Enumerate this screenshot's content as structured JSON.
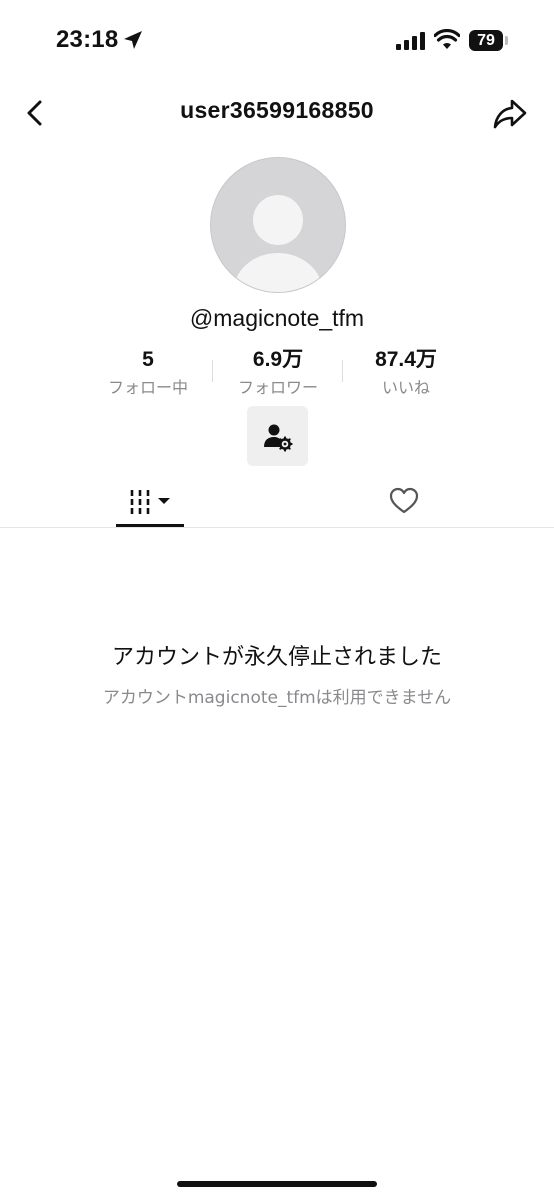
{
  "status_bar": {
    "time": "23:18",
    "battery": "79",
    "icons": [
      "location-arrow-icon",
      "signal-icon",
      "wifi-icon",
      "battery-icon"
    ]
  },
  "header": {
    "title": "user36599168850",
    "back_icon": "chevron-left-icon",
    "share_icon": "share-arrow-icon"
  },
  "profile": {
    "avatar_icon": "default-avatar",
    "username": "@magicnote_tfm",
    "stats": {
      "following": {
        "value": "5",
        "label": "フォロー中"
      },
      "followers": {
        "value": "6.9万",
        "label": "フォロワー"
      },
      "likes": {
        "value": "87.4万",
        "label": "いいね"
      }
    },
    "settings_icon": "user-settings-icon"
  },
  "tabs": [
    {
      "name": "videos",
      "icon": "grid-bars-dropdown-icon",
      "active": true
    },
    {
      "name": "liked",
      "icon": "heart-outline-icon",
      "active": false
    }
  ],
  "message": {
    "title": "アカウントが永久停止されました",
    "subtitle": "アカウントmagicnote_tfmは利用できません"
  },
  "colors": {
    "text": "#111111",
    "muted": "#8a8a8e",
    "avatar_bg": "#d5d5d8",
    "button_bg": "#efeff0",
    "divider": "#e6e6e8"
  }
}
